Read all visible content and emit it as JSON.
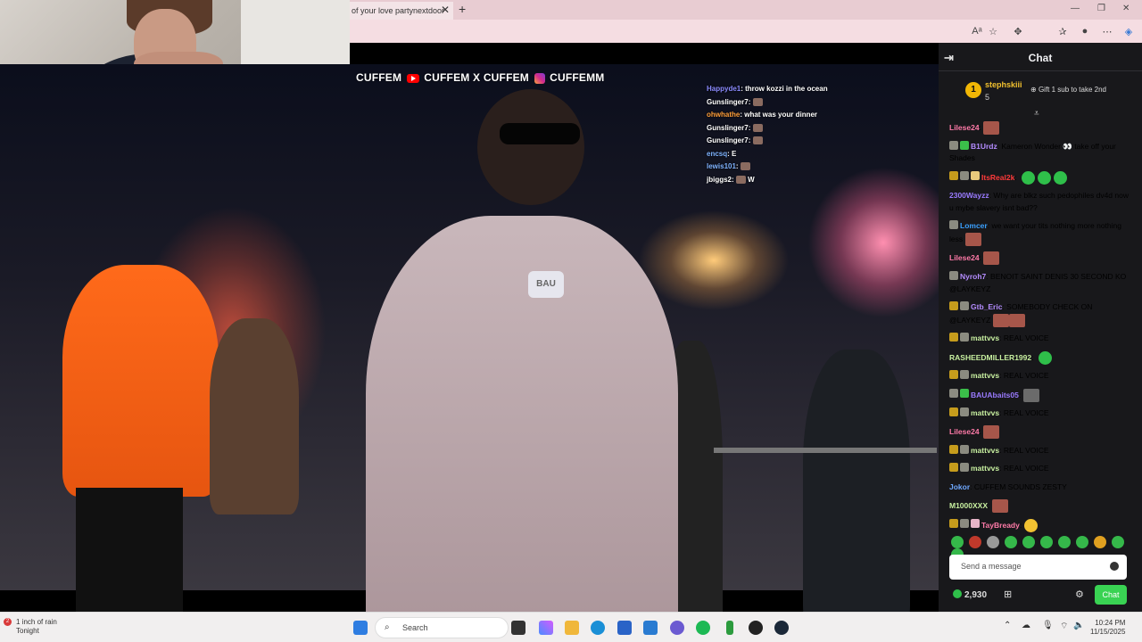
{
  "browser": {
    "tab_title": "of your love partynextdoor",
    "close_label": "✕",
    "new_tab_label": "+",
    "window_controls": [
      "—",
      "❐",
      "✕"
    ],
    "toolbar_icons": [
      "read-aloud-icon",
      "favorite-star-icon",
      "extensions-icon",
      "favorites-icon",
      "profile-icon",
      "more-icon",
      "copilot-icon"
    ]
  },
  "stream_overlay": {
    "brand_text_1": "CUFFEM",
    "brand_text_2": "CUFFEM",
    "separator": "X",
    "brand_text_3": "CUFFEM",
    "brand_text_4": "CUFFEMM"
  },
  "video_chat": [
    {
      "user": "Happyde1",
      "text": ": throw kozzi in the ocean",
      "color": "#8b8bff"
    },
    {
      "user": "Gunslinger7",
      "text": ":",
      "color": "#ffffff"
    },
    {
      "user": "ohwhathe",
      "text": ": what was your dinner",
      "color": "#ff9f3a"
    },
    {
      "user": "Gunslinger7",
      "text": ":",
      "color": "#ffffff"
    },
    {
      "user": "Gunslinger7",
      "text": ":",
      "color": "#ffffff"
    },
    {
      "user": "encsq",
      "text": ": E",
      "color": "#7fb3ff"
    },
    {
      "user": "lewis101",
      "text": ":",
      "color": "#7fb3ff"
    },
    {
      "user": "jbiggs2",
      "text": ":",
      "color": "#ffffff"
    }
  ],
  "video_chat_last_word": "W",
  "video_badge": "BAU",
  "chat": {
    "header": "Chat",
    "pinned_user": "stephskiii",
    "pinned_count": "5",
    "pinned_rank": "1",
    "gift_text": "Gift 1 sub to take 2nd",
    "messages": [
      {
        "user": "Lilese24",
        "text": "",
        "color": "#ff7aa8"
      },
      {
        "user": "B1Urdz",
        "text": "Kameron Wonder 👀 take off your Shades",
        "color": "#b48cff"
      },
      {
        "user": "ItsReal2k",
        "text": "",
        "color": "#ff3a3a"
      },
      {
        "user": "2300Wayzz",
        "text": "Why are blkz such pedophiles dv4d now u mybe slavery isnt bad??",
        "color": "#9a7bff"
      },
      {
        "user": "Lomcer",
        "text": "we want your tits nothing more nothing less",
        "color": "#3aa0ff"
      },
      {
        "user": "Lilese24",
        "text": "",
        "color": "#ff7aa8"
      },
      {
        "user": "Nyroh7",
        "text": "BENOIT SAINT DENIS 30 SECOND KO @LAYKEYZ",
        "color": "#b48cff"
      },
      {
        "user": "Gtb_Eric",
        "text": "SOMEBODY CHECK ON @LAYKEYZ",
        "color": "#b48cff"
      },
      {
        "user": "mattvvs",
        "text": "REAL VOICE",
        "color": "#c8f0a0"
      },
      {
        "user": "RASHEEDMILLER1992",
        "text": "",
        "color": "#c8f0a0"
      },
      {
        "user": "mattvvs",
        "text": "REAL VOICE",
        "color": "#c8f0a0"
      },
      {
        "user": "BAUAbaits05",
        "text": "",
        "color": "#9a7bff"
      },
      {
        "user": "mattvvs",
        "text": "REAL VOICE",
        "color": "#c8f0a0"
      },
      {
        "user": "Lilese24",
        "text": "",
        "color": "#ff7aa8"
      },
      {
        "user": "mattvvs",
        "text": "REAL VOICE",
        "color": "#c8f0a0"
      },
      {
        "user": "mattvvs",
        "text": "REAL VOICE",
        "color": "#c8f0a0"
      },
      {
        "user": "Jokor",
        "text": "CUFFEM SOUNDS ZESTY",
        "color": "#6fa8ff"
      },
      {
        "user": "M1000XXX",
        "text": "",
        "color": "#c8f0a0"
      },
      {
        "user": "TayBready",
        "text": "",
        "color": "#ff7aa8"
      }
    ],
    "input_placeholder": "Send a message",
    "points": "2,930",
    "send_label": "Chat"
  },
  "taskbar": {
    "weather_line1": "1 inch of rain",
    "weather_line2": "Tonight",
    "weather_badge": "2",
    "search_label": "Search",
    "time": "10:24 PM",
    "date": "11/15/2025"
  }
}
